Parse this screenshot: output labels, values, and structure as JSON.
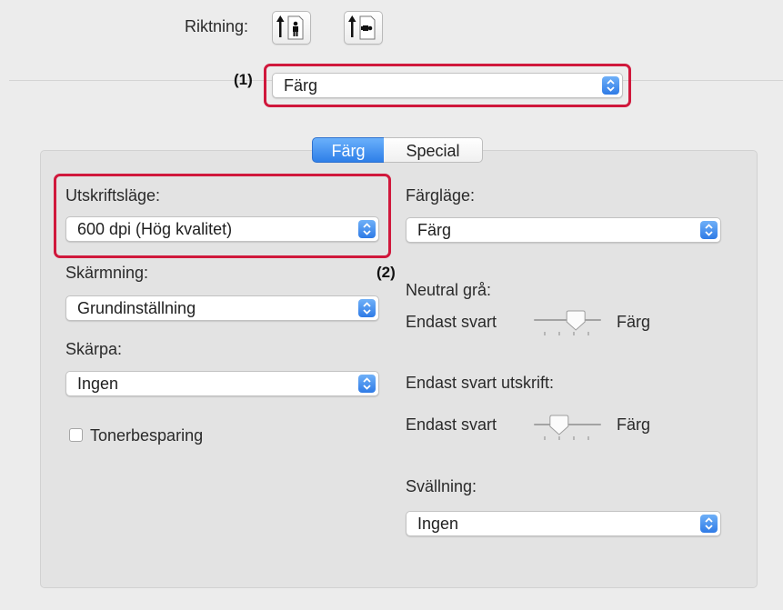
{
  "header": {
    "orientation_label": "Riktning:",
    "orientation_portrait_icon": "portrait-orientation-icon",
    "orientation_landscape_icon": "landscape-orientation-icon"
  },
  "panel_select": {
    "value": "Färg"
  },
  "callouts": {
    "one": "(1)",
    "two": "(2)"
  },
  "tabs": [
    {
      "label": "Färg",
      "selected": true
    },
    {
      "label": "Special",
      "selected": false
    }
  ],
  "left": {
    "print_mode": {
      "label": "Utskriftsläge:",
      "value": "600 dpi (Hög kvalitet)"
    },
    "screening": {
      "label": "Skärmning:",
      "value": "Grundinställning"
    },
    "sharpness": {
      "label": "Skärpa:",
      "value": "Ingen"
    },
    "toner_save": {
      "label": "Tonerbesparing",
      "checked": false
    }
  },
  "right": {
    "color_mode": {
      "label": "Färgläge:",
      "value": "Färg"
    },
    "neutral_gray": {
      "label": "Neutral grå:",
      "min_label": "Endast svart",
      "max_label": "Färg",
      "level": 0.67
    },
    "black_only": {
      "label": "Endast svart utskrift:",
      "min_label": "Endast svart",
      "max_label": "Färg",
      "level": 0.33
    },
    "swelling": {
      "label": "Svällning:",
      "value": "Ingen"
    }
  },
  "colors": {
    "accent": "#3a86f0",
    "highlight": "#d0183c"
  }
}
